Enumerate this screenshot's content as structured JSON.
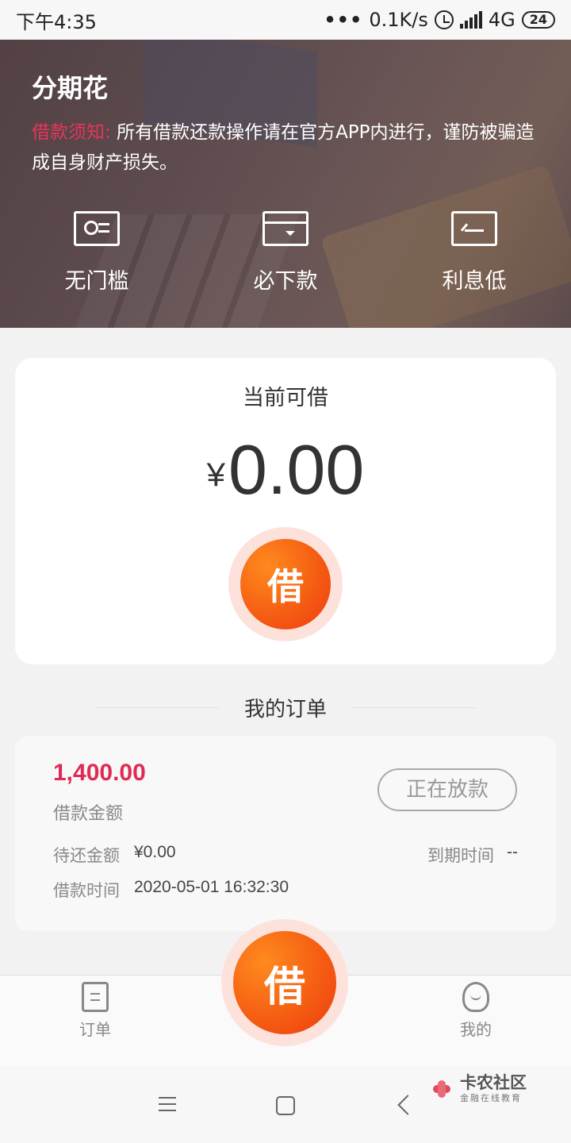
{
  "status_bar": {
    "time": "下午4:35",
    "network_speed": "0.1K/s",
    "network_type": "4G",
    "battery": "24"
  },
  "header": {
    "app_name": "分期花",
    "notice_label": "借款须知:",
    "notice_text": "所有借款还款操作请在官方APP内进行，谨防被骗造成自身财产损失。",
    "features": [
      {
        "label": "无门槛",
        "icon": "id-card-icon"
      },
      {
        "label": "必下款",
        "icon": "card-download-icon"
      },
      {
        "label": "利息低",
        "icon": "return-arrow-icon"
      }
    ]
  },
  "loan": {
    "title": "当前可借",
    "currency": "¥",
    "amount": "0.00",
    "button_label": "借"
  },
  "orders": {
    "section_title": "我的订单",
    "items": [
      {
        "amount": "1,400.00",
        "amount_label": "借款金额",
        "status": "正在放款",
        "pending_label": "待还金额",
        "pending_value": "¥0.00",
        "due_label": "到期时间",
        "due_value": "--",
        "time_label": "借款时间",
        "time_value": "2020-05-01 16:32:30"
      }
    ]
  },
  "tabbar": {
    "orders_label": "订单",
    "borrow_label": "借",
    "me_label": "我的"
  },
  "watermark": {
    "title": "卡农社区",
    "subtitle": "金融在线教育"
  },
  "colors": {
    "accent": "#f45a12",
    "notice_label": "#e8345a",
    "order_amount": "#e02a55"
  }
}
